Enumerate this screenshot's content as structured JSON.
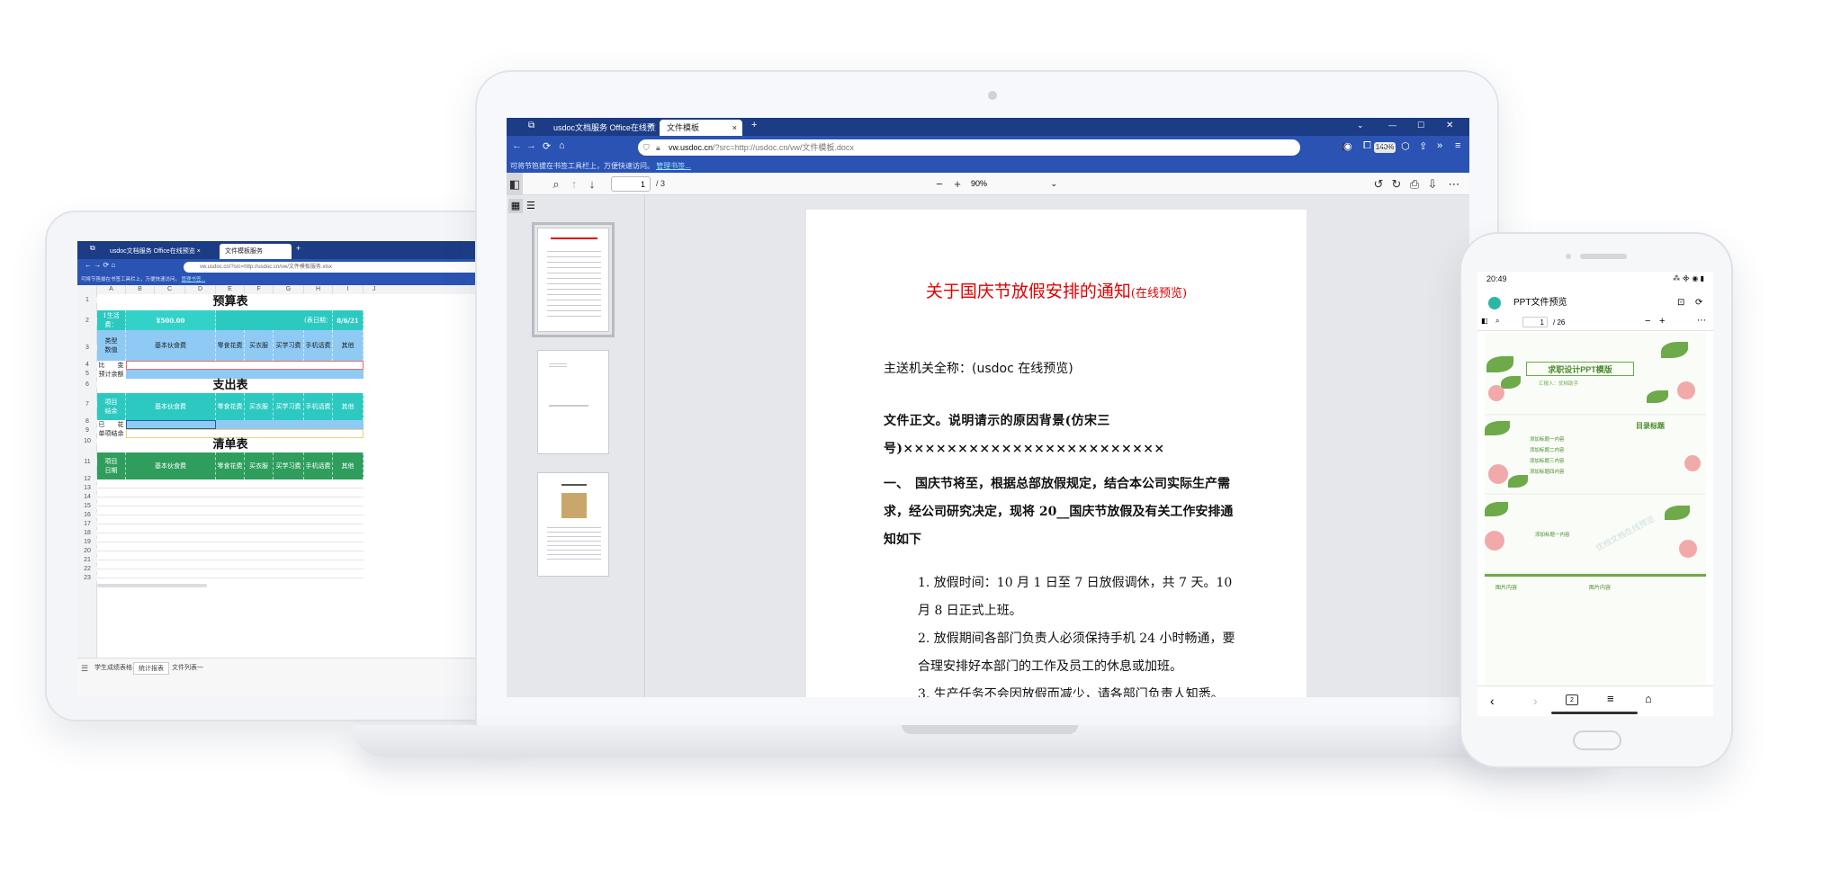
{
  "tablet": {
    "tabs": [
      "usdoc文档服务 Office在线预览",
      "文件模板服务"
    ],
    "url": "vw.usdoc.cn/?src=http://usdoc.cn/vw/文件模板服务.xlsx",
    "info": "可将节笆拔在书签工具栏上，万便快速访问。",
    "info_link": "管理书签...",
    "columns": [
      "A",
      "B",
      "C",
      "D",
      "E",
      "F",
      "G",
      "H",
      "I",
      "J"
    ],
    "rows": [
      "1",
      "2",
      "3",
      "4",
      "5",
      "6",
      "7",
      "8",
      "9",
      "10",
      "11",
      "12",
      "13",
      "14",
      "15",
      "16",
      "17",
      "18",
      "19",
      "20",
      "21",
      "22",
      "23"
    ],
    "sections": {
      "budget": "预算表",
      "expense": "支出表",
      "list": "清单表"
    },
    "row2": {
      "label": "1生活费：",
      "amount": "¥500.00",
      "date_label": "(表日期：",
      "date": "8/6/21"
    },
    "row3": {
      "label": "类型\n数值",
      "c1": "基本伙食费",
      "c2": "零食花费",
      "c3": "买衣服",
      "c4": "买学习费",
      "c5": "手机话费",
      "c6": "其他"
    },
    "row4": "比　　变",
    "row5": "预计余额",
    "row7": {
      "label": "项目\n结余",
      "c1": "基本伙食费",
      "c2": "零食花费",
      "c3": "买衣服",
      "c4": "买学习费",
      "c5": "手机话费",
      "c6": "其他"
    },
    "row8": "已　　花",
    "row9": "单项结余",
    "row11": {
      "label": "项目\n日期",
      "c1": "基本伙食费",
      "c2": "零食花费",
      "c3": "买衣服",
      "c4": "买学习费",
      "c5": "手机话费",
      "c6": "其他"
    },
    "sheet_tabs": [
      "学生成绩表格",
      "统计报表",
      "文件列表一"
    ]
  },
  "laptop": {
    "tabs": [
      "usdoc文档服务 Office在线预览",
      "文件模板"
    ],
    "url_host": "vw.usdoc.cn",
    "url_path": "/?src=http://usdoc.cn/vw/文件模板.docx",
    "zoom_chip": "140%",
    "info": "可将节笆拔在书签工具栏上，万便快速访问。",
    "info_link": "管理书签...",
    "page_current": "1",
    "page_total": "/ 3",
    "zoom": "90%",
    "doc": {
      "title": "关于国庆节放假安排的通知",
      "title_suffix": "(在线预览)",
      "recipient": "主送机关全称：(usdoc 在线预览)",
      "body1": "文件正文。说明请示的原因背景(仿宋三号)××××××××××××××××××××××××",
      "item_heading": "一、　国庆节将至，根据总部放假规定，结合本公司实际生产需求，经公司研究决定，现将 20__国庆节放假及有关工作安排通知如下",
      "list": [
        "1. 放假时间：10 月 1 日至 7 日放假调休，共 7 天。10 月 8 日正式上班。",
        "2. 放假期间各部门负责人必须保持手机 24 小时畅通，要合理安排好本部门的工作及员工的休息或加班。",
        "3. 生产任务不会因放假而减少，请各部门负责人知悉。"
      ]
    }
  },
  "phone": {
    "time": "20:49",
    "status_icons": "⁂ ᯽ ◉ ▮",
    "title": "PPT文件预览",
    "page_current": "1",
    "page_total": "/ 26",
    "slide1_title": "求职设计PPT模版",
    "slide1_sub": "汇报人：优档助手",
    "slide2_title": "目录标题",
    "slide2_items": [
      "添加标题一内容",
      "添加标题二内容",
      "添加标题三内容",
      "添加标题四内容"
    ],
    "slide3_text": "添加标题一内容",
    "slide4_left": "图片内容",
    "slide4_right": "图片内容",
    "tab_count": "2",
    "watermark": "优档文档在线预览"
  },
  "colors": {
    "browser_dark": "#1c3c86",
    "browser_blue": "#2a53b3",
    "teal": "#2cc9c1",
    "sky": "#8fcaf4",
    "green": "#2f9e5c",
    "title_red": "#e00000"
  }
}
